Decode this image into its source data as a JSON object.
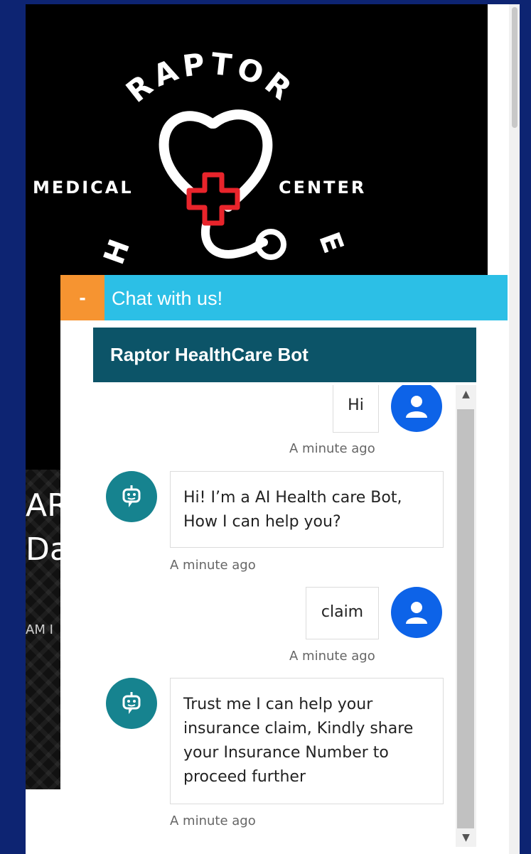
{
  "background_site": {
    "logo": {
      "top_word": "RAPTOR",
      "left_word": "MEDICAL",
      "right_word": "CENTER"
    },
    "headline_line1": "AR",
    "headline_line2": "Da",
    "meta_text": "AM I"
  },
  "chat": {
    "minimize_label": "-",
    "header_title": "Chat with us!",
    "bot_name": "Raptor HealthCare Bot",
    "messages": [
      {
        "sender": "user",
        "text": "Hi",
        "time": "A minute ago"
      },
      {
        "sender": "bot",
        "text": "Hi! I’m a AI Health care Bot, How I can help you?",
        "time": "A minute ago"
      },
      {
        "sender": "user",
        "text": "claim",
        "time": "A minute ago"
      },
      {
        "sender": "bot",
        "text": "Trust me I can help your insurance claim, Kindly share your Insurance Number to proceed further",
        "time": "A minute ago"
      }
    ]
  },
  "colors": {
    "page_background": "#0d2472",
    "chat_header": "#2cbfe6",
    "minimize_button": "#f69431",
    "bot_banner": "#0c5468",
    "user_avatar": "#0d63e8",
    "bot_avatar": "#16838f"
  },
  "icons": {
    "user_avatar": "person-icon",
    "bot_avatar": "robot-icon",
    "scroll_up": "arrow-up-icon",
    "scroll_down": "arrow-down-icon"
  }
}
